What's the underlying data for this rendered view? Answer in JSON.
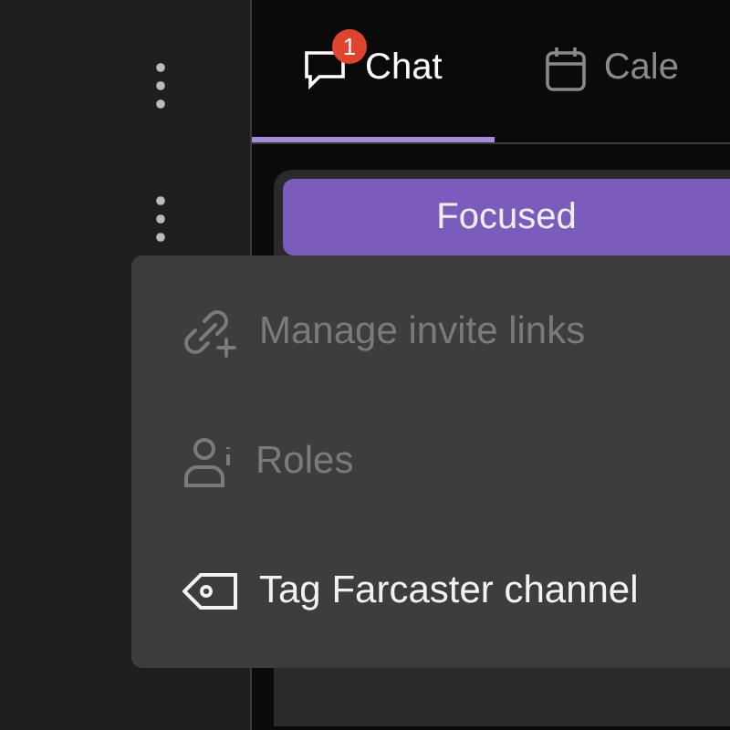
{
  "tabs": [
    {
      "label": "Chat",
      "kind": "chat",
      "badge": "1",
      "selected": true
    },
    {
      "label": "Cale",
      "kind": "calendar",
      "selected": false
    }
  ],
  "filter": {
    "label": "Focused",
    "selected": true
  },
  "menu": {
    "items": [
      {
        "label": "Manage invite links",
        "kind": "link",
        "disabled": true
      },
      {
        "label": "Roles",
        "kind": "roles",
        "disabled": true
      },
      {
        "label": "Tag Farcaster channel",
        "kind": "tag",
        "disabled": false
      }
    ]
  }
}
